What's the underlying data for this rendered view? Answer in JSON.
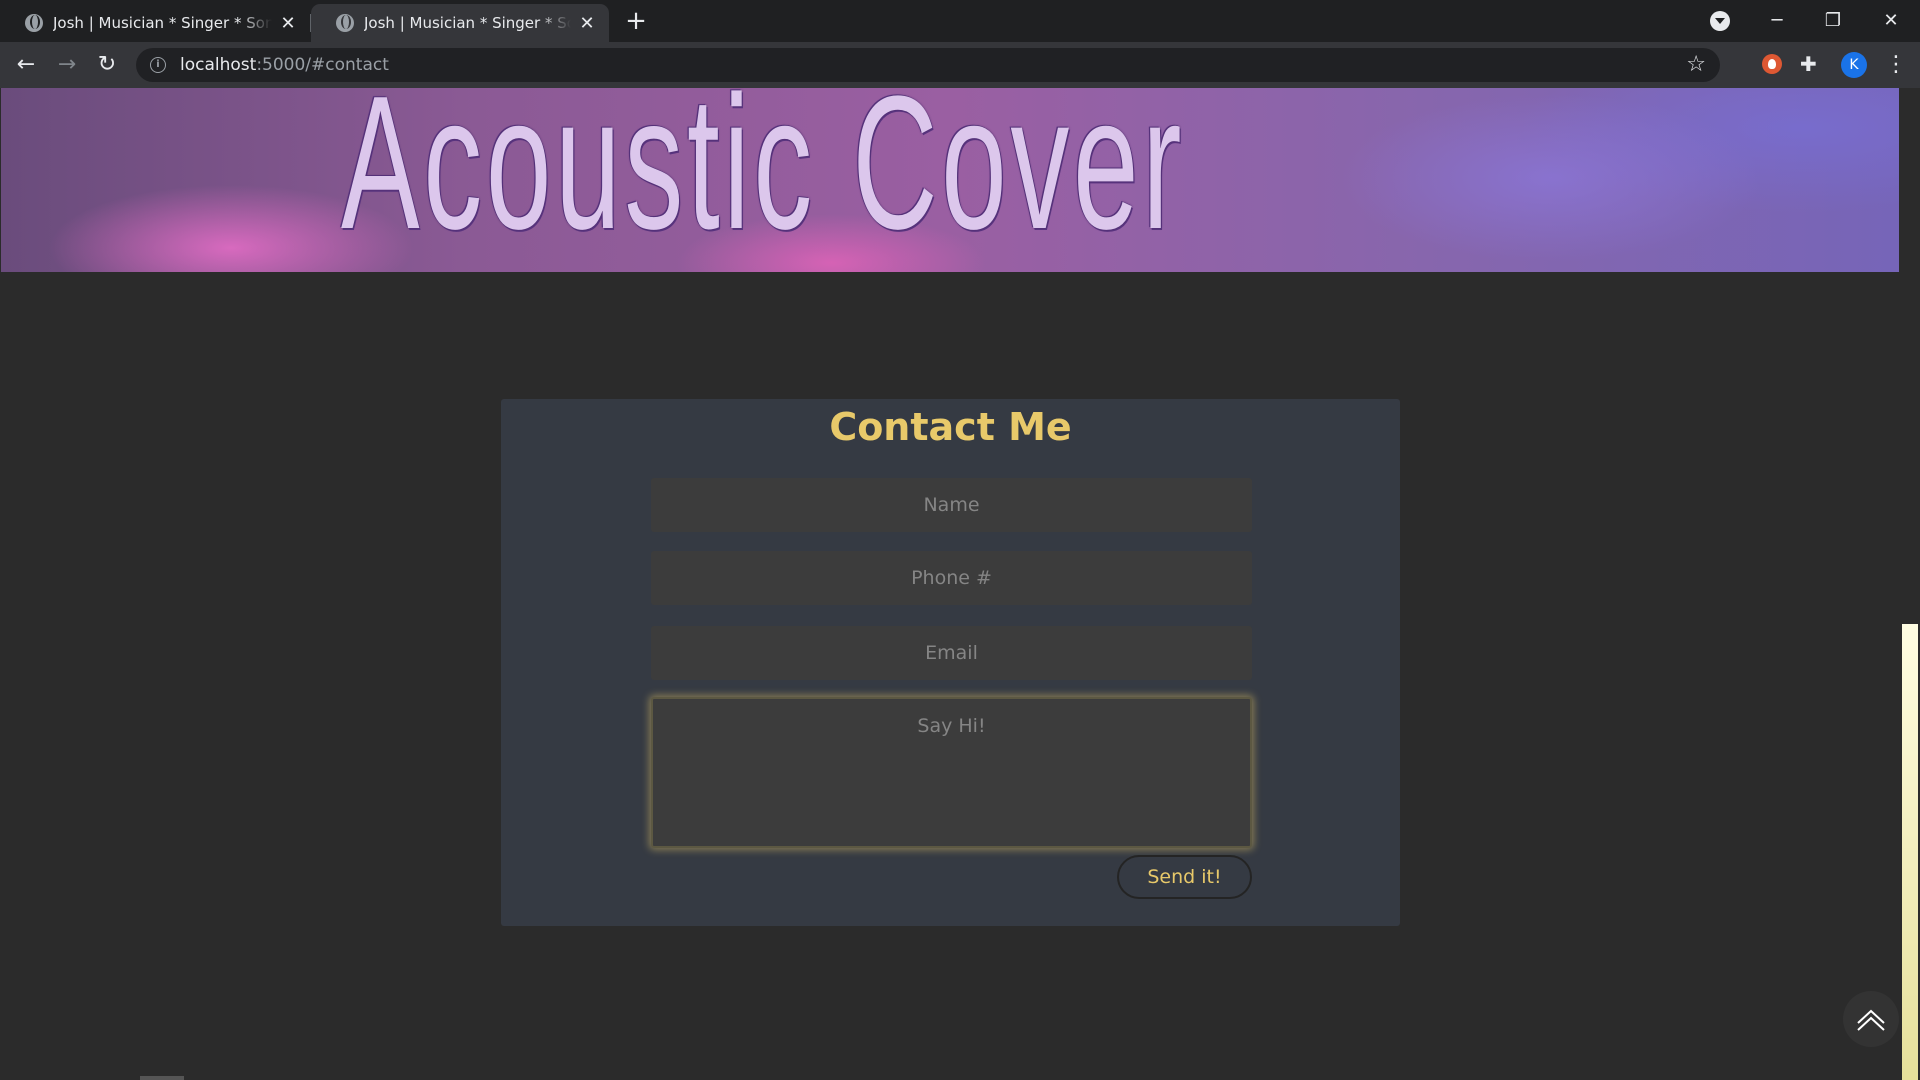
{
  "browser": {
    "tabs": [
      {
        "title": "Josh | Musician * Singer * Songwriter",
        "active": false
      },
      {
        "title": "Josh | Musician * Singer * Songwriter",
        "active": true
      }
    ],
    "url": {
      "host": "localhost",
      "path": ":5000/#contact"
    },
    "profile_initial": "K"
  },
  "banner": {
    "title": "Acoustic Cover"
  },
  "contact": {
    "heading": "Contact Me",
    "name_placeholder": "Name",
    "phone_placeholder": "Phone #",
    "email_placeholder": "Email",
    "message_placeholder": "Say Hi!",
    "send_label": "Send it!"
  },
  "colors": {
    "accent": "#e8c96a",
    "card": "#353a43",
    "page_bg": "#2b2b2b"
  },
  "icons": [
    "globe-icon",
    "close-icon",
    "plus-icon",
    "tab-search-icon",
    "minimize-icon",
    "restore-icon",
    "window-close-icon",
    "back-icon",
    "forward-icon",
    "reload-icon",
    "info-icon",
    "star-icon",
    "duckduckgo-icon",
    "puzzle-icon",
    "menu-icon",
    "scroll-up-icon"
  ]
}
